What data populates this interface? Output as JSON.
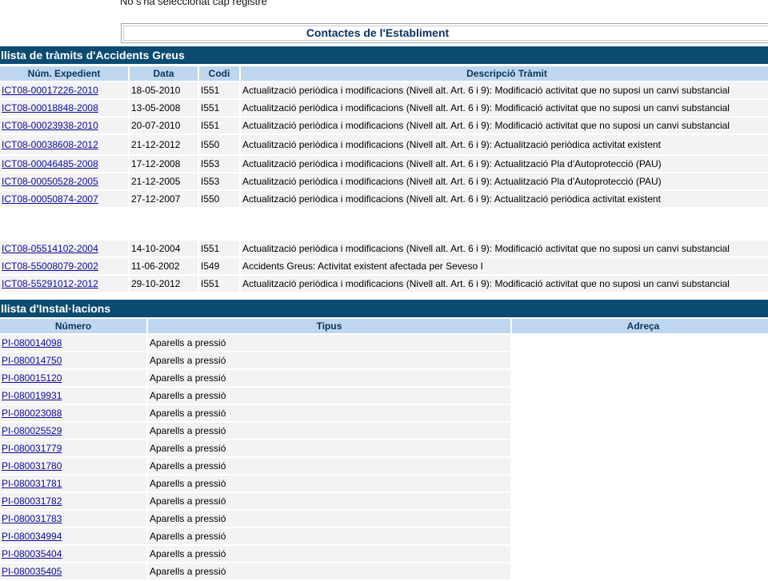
{
  "top_message": "No s'ha seleccionat cap registre",
  "contacts_title": "Contactes de l'Establiment",
  "tramits": {
    "title": "llista de tràmits d'Accidents Greus",
    "columns": [
      "Núm. Expedient",
      "Data",
      "Codi",
      "Descripció Tràmit"
    ],
    "rows": [
      {
        "exp": "ICT08-00017226-2010",
        "date": "18-05-2010",
        "code": "I551",
        "desc": "Actualització periòdica i modificacions (Nivell alt. Art. 6 i 9): Modificació activitat que no suposi un canvi substancial"
      },
      {
        "exp": "ICT08-00018848-2008",
        "date": "13-05-2008",
        "code": "I551",
        "desc": "Actualització periòdica i modificacions (Nivell alt. Art. 6 i 9): Modificació activitat que no suposi un canvi substancial"
      },
      {
        "exp": "ICT08-00023938-2010",
        "date": "20-07-2010",
        "code": "I551",
        "desc": "Actualització periòdica i modificacions (Nivell alt. Art. 6 i 9): Modificació activitat que no suposi un canvi substancial"
      },
      {
        "exp": "ICT08-00038608-2012",
        "date": "21-12-2012",
        "code": "I550",
        "desc": "Actualització periòdica i modificacions (Nivell alt. Art. 6 i 9): Actualització periòdica activitat existent"
      },
      {
        "exp": "ICT08-00046485-2008",
        "date": "17-12-2008",
        "code": "I553",
        "desc": "Actualització periòdica i modificacions (Nivell alt. Art. 6 i 9): Actualització Pla d'Autoprotecció (PAU)"
      },
      {
        "exp": "ICT08-00050528-2005",
        "date": "21-12-2005",
        "code": "I553",
        "desc": "Actualització periòdica i modificacions (Nivell alt. Art. 6 i 9): Actualització Pla d'Autoprotecció (PAU)"
      },
      {
        "exp": "ICT08-00050874-2007",
        "date": "27-12-2007",
        "code": "I550",
        "desc": "Actualització periòdica i modificacions (Nivell alt. Art. 6 i 9): Actualització periòdica activitat existent"
      },
      {
        "exp": "ICT08-05514102-2004",
        "date": "14-10-2004",
        "code": "I551",
        "desc": "Actualització periòdica i modificacions (Nivell alt. Art. 6 i 9): Modificació activitat que no suposi un canvi substancial"
      },
      {
        "exp": "ICT08-55008079-2002",
        "date": "11-06-2002",
        "code": "I549",
        "desc": "Accidents Greus: Activitat existent afectada per Seveso I"
      },
      {
        "exp": "ICT08-55291012-2012",
        "date": "29-10-2012",
        "code": "I551",
        "desc": "Actualització periòdica i modificacions (Nivell alt. Art. 6 i 9): Modificació activitat que no suposi un canvi substancial"
      }
    ]
  },
  "instal": {
    "title": "llista d'Instal·lacions",
    "columns": [
      "Número",
      "Tipus",
      "Adreça"
    ],
    "rows": [
      {
        "num": "PI-080014098",
        "tipus": "Aparells a pressió"
      },
      {
        "num": "PI-080014750",
        "tipus": "Aparells a pressió"
      },
      {
        "num": "PI-080015120",
        "tipus": "Aparells a pressió"
      },
      {
        "num": "PI-080019931",
        "tipus": "Aparells a pressió"
      },
      {
        "num": "PI-080023088",
        "tipus": "Aparells a pressió"
      },
      {
        "num": "PI-080025529",
        "tipus": "Aparells a pressió"
      },
      {
        "num": "PI-080031779",
        "tipus": "Aparells a pressió"
      },
      {
        "num": "PI-080031780",
        "tipus": "Aparells a pressió"
      },
      {
        "num": "PI-080031781",
        "tipus": "Aparells a pressió"
      },
      {
        "num": "PI-080031782",
        "tipus": "Aparells a pressió"
      },
      {
        "num": "PI-080031783",
        "tipus": "Aparells a pressió"
      },
      {
        "num": "PI-080034994",
        "tipus": "Aparells a pressió"
      },
      {
        "num": "PI-080035404",
        "tipus": "Aparells a pressió"
      },
      {
        "num": "PI-080035405",
        "tipus": "Aparells a pressió"
      }
    ]
  }
}
